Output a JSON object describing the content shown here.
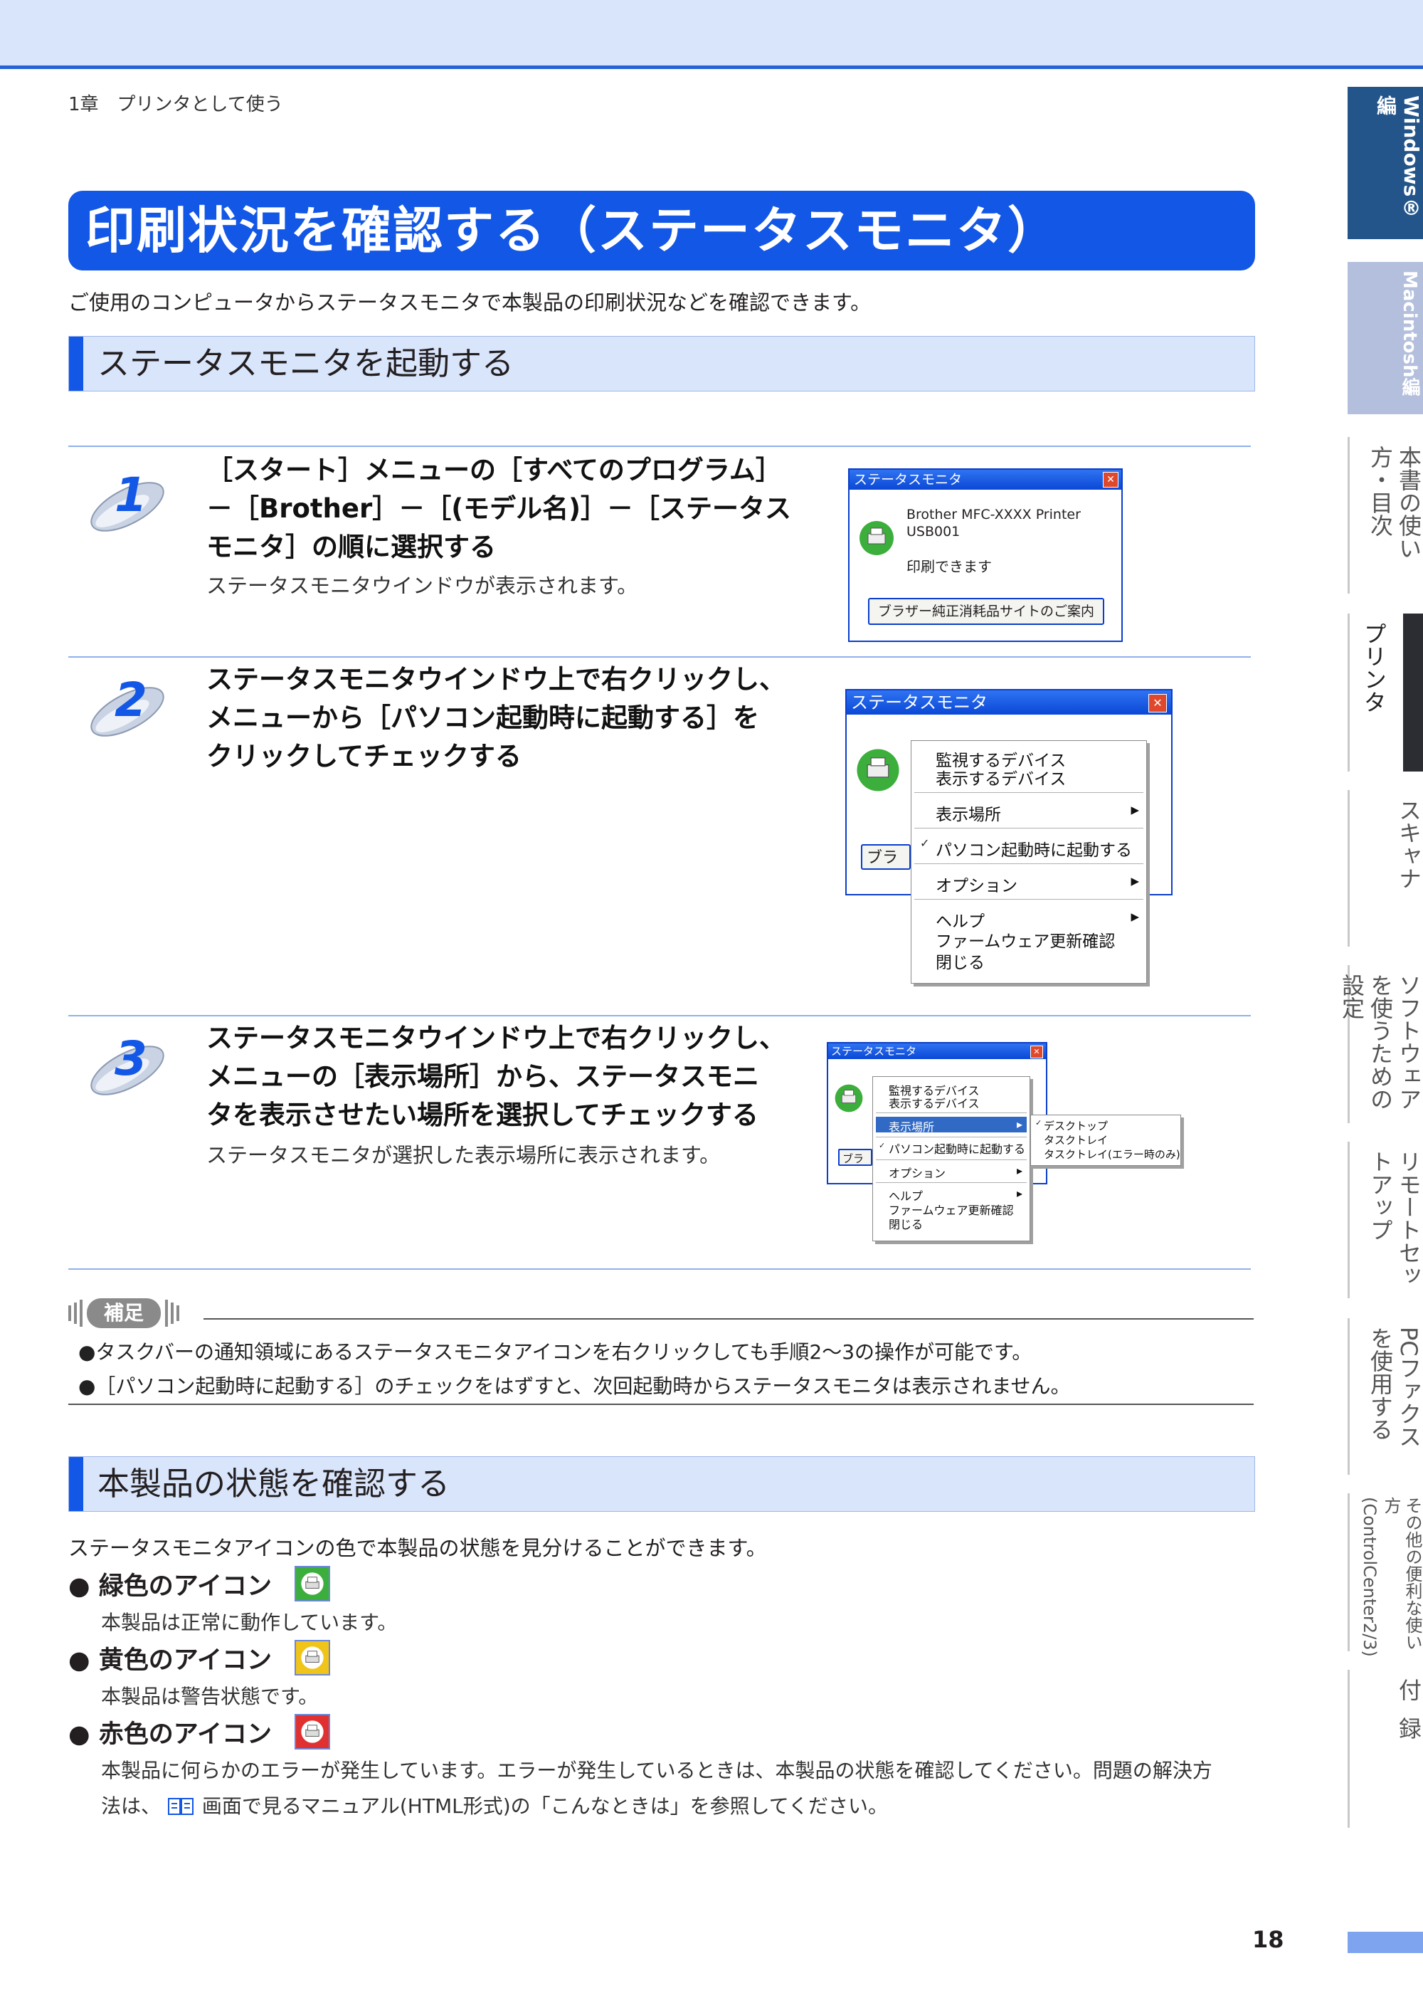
{
  "chapter": "1章　プリンタとして使う",
  "title": "印刷状況を確認する（ステータスモニタ）",
  "intro": "ご使用のコンピュータからステータスモニタで本製品の印刷状況などを確認できます。",
  "section1": {
    "heading": "ステータスモニタを起動する",
    "steps": [
      {
        "num": "1",
        "lines": [
          "［スタート］メニューの［すべてのプログラム］",
          "－［Brother］－［(モデル名)］－［ステータス",
          "モニタ］の順に選択する"
        ],
        "sub": "ステータスモニタウインドウが表示されます。"
      },
      {
        "num": "2",
        "lines": [
          "ステータスモニタウインドウ上で右クリックし、",
          "メニューから［パソコン起動時に起動する］を",
          "クリックしてチェックする"
        ],
        "sub": ""
      },
      {
        "num": "3",
        "lines": [
          "ステータスモニタウインドウ上で右クリックし、",
          "メニューの［表示場所］から、ステータスモニ",
          "タを表示させたい場所を選択してチェックする"
        ],
        "sub": "ステータスモニタが選択した表示場所に表示されます。"
      }
    ],
    "shot1": {
      "title": "ステータスモニタ",
      "line1": "Brother  MFC-XXXX  Printer",
      "line2": "USB001",
      "status": "印刷できます",
      "button": "ブラザー純正消耗品サイトのご案内"
    },
    "shot2": {
      "title": "ステータスモニタ",
      "button_partial": "ブラ",
      "menu": [
        "監視するデバイス",
        "表示するデバイス",
        "表示場所",
        "パソコン起動時に起動する",
        "オプション",
        "ヘルプ",
        "ファームウェア更新確認",
        "閉じる"
      ],
      "check": "✓"
    },
    "shot3": {
      "title": "ステータスモニタ",
      "button_partial": "ブラ",
      "menu": [
        "監視するデバイス",
        "表示するデバイス",
        "表示場所",
        "パソコン起動時に起動する",
        "オプション",
        "ヘルプ",
        "ファームウェア更新確認",
        "閉じる"
      ],
      "submenu": [
        "デスクトップ",
        "タスクトレイ",
        "タスクトレイ(エラー時のみ)"
      ],
      "check": "✓"
    }
  },
  "note": {
    "label": "補足",
    "items": [
      "●タスクバーの通知領域にあるステータスモニタアイコンを右クリックしても手順2～3の操作が可能です。",
      "●［パソコン起動時に起動する］のチェックをはずすと、次回起動時からステータスモニタは表示されません。"
    ]
  },
  "section2": {
    "heading": "本製品の状態を確認する",
    "intro": "ステータスモニタアイコンの色で本製品の状態を見分けることができます。",
    "bullet_mark": "●",
    "icons": [
      {
        "label": "緑色のアイコン",
        "desc": "本製品は正常に動作しています。",
        "color": "#3cae3c"
      },
      {
        "label": "黄色のアイコン",
        "desc": "本製品は警告状態です。",
        "color": "#f0c419"
      },
      {
        "label": "赤色のアイコン",
        "desc": "本製品に何らかのエラーが発生しています。エラーが発生しているときは、本製品の状態を確認してください。問題の解決方",
        "color": "#e03030"
      }
    ],
    "error_line2_pre": "法は、",
    "error_line2_post": "画面で見るマニュアル(HTML形式)の「こんなときは」を参照してください。"
  },
  "sidebar": {
    "tabs": [
      "Windows®編",
      "Macintosh編",
      "本書の使い方・目次",
      "プリンタ",
      "スキャナ",
      "ソフトウェアを使うための設定",
      "リモートセットアップ",
      "PCファクスを使用する",
      "その他の便利な使い方(ControlCenter2/3)",
      "付録"
    ]
  },
  "page_number": "18",
  "colors": {
    "accent": "#1257e6",
    "band": "#d9e5fb",
    "tab_active": "#23558a",
    "tab_dark": "#2b2d33"
  }
}
